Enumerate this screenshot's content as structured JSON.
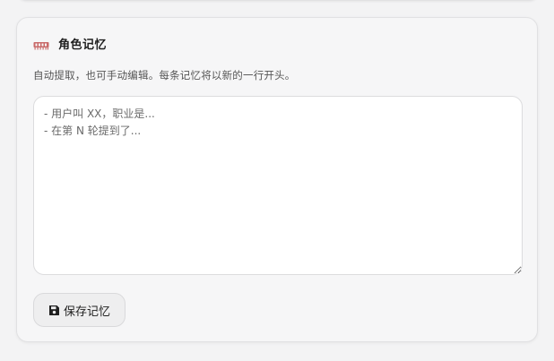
{
  "memory_card": {
    "title": "角色记忆",
    "title_icon": "memory-chip-icon",
    "description": "自动提取，也可手动编辑。每条记忆将以新的一行开头。",
    "textarea": {
      "value": "",
      "placeholder": "- 用户叫 XX，职业是...\n- 在第 N 轮提到了..."
    },
    "save_button": {
      "label": "保存记忆",
      "icon": "floppy-disk-icon"
    }
  },
  "colors": {
    "icon_accent": "#c96a6a",
    "card_background": "#f6f6f7",
    "textarea_background": "#ffffff",
    "button_background": "#eeeeef"
  }
}
